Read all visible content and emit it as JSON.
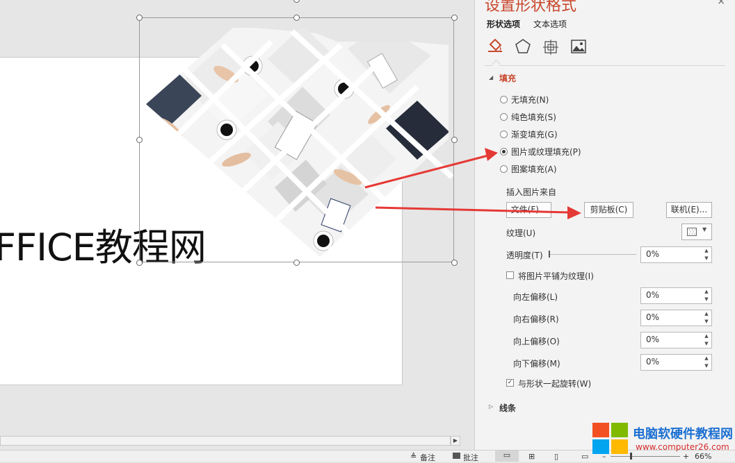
{
  "slide": {
    "text": "FFICE教程网"
  },
  "panel": {
    "title": "设置形状格式",
    "close": "×",
    "tabs": [
      "形状选项",
      "文本选项"
    ],
    "icons": [
      "fill-line-icon",
      "effects-pentagon-icon",
      "size-layout-icon",
      "picture-icon"
    ],
    "fill_section": "填充",
    "fill_options": [
      {
        "label": "无填充(N)",
        "selected": false
      },
      {
        "label": "纯色填充(S)",
        "selected": false
      },
      {
        "label": "渐变填充(G)",
        "selected": false
      },
      {
        "label": "图片或纹理填充(P)",
        "selected": true
      },
      {
        "label": "图案填充(A)",
        "selected": false
      }
    ],
    "insert_from": "插入图片来自",
    "btn_file": "文件(F)...",
    "btn_clipboard": "剪贴板(C)",
    "btn_online": "联机(E)...",
    "texture_label": "纹理(U)",
    "transparency_label": "透明度(T)",
    "transparency_value": "0%",
    "tile_label": "将图片平铺为纹理(I)",
    "tile_checked": false,
    "offsets": [
      {
        "label": "向左偏移(L)",
        "value": "0%"
      },
      {
        "label": "向右偏移(R)",
        "value": "0%"
      },
      {
        "label": "向上偏移(O)",
        "value": "0%"
      },
      {
        "label": "向下偏移(M)",
        "value": "0%"
      }
    ],
    "rotate_label": "与形状一起旋转(W)",
    "rotate_checked": true,
    "line_section": "线条"
  },
  "statusbar": {
    "notes": "备注",
    "comments": "批注",
    "zoom": "66%"
  },
  "watermark": {
    "text1": "电脑软硬件教程网",
    "text2": "www.computer26.com"
  },
  "colors": {
    "accent": "#c8472c",
    "arrow": "#e53935",
    "panel_bg": "#f3f3f3"
  }
}
